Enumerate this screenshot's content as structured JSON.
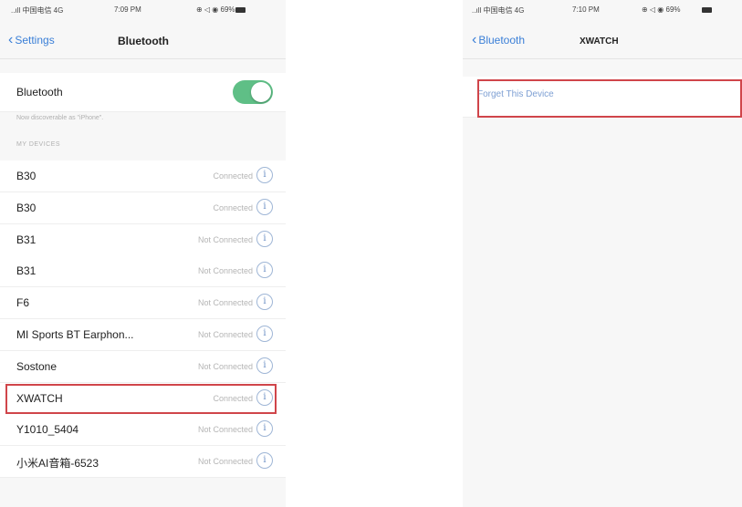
{
  "left": {
    "status": {
      "carrier": "..ıll 中国电信 4G",
      "time": "7:09 PM",
      "battery": "⊕ ◁ ◉ 69%"
    },
    "nav": {
      "back": "Settings",
      "title": "Bluetooth"
    },
    "bluetooth": {
      "label": "Bluetooth",
      "enabled": true,
      "discoverable": "Now discoverable as \"iPhone\"."
    },
    "section_header": "MY DEVICES",
    "devices": [
      {
        "name": "B30",
        "status": "Connected"
      },
      {
        "name": "B30",
        "status": "Connected"
      },
      {
        "name": "B31",
        "status": "Not Connected"
      },
      {
        "name": "B31",
        "status": "Not Connected"
      },
      {
        "name": "F6",
        "status": "Not Connected"
      },
      {
        "name": "MI Sports BT Earphon...",
        "status": "Not Connected"
      },
      {
        "name": "Sostone",
        "status": "Not Connected"
      },
      {
        "name": "XWATCH",
        "status": "Connected"
      },
      {
        "name": "Y1010_5404",
        "status": "Not Connected"
      },
      {
        "name": "小米AI音箱-6523",
        "status": "Not Connected"
      }
    ],
    "info_glyph": "i"
  },
  "right": {
    "status": {
      "carrier": "..ıll 中国电信 4G",
      "time": "7:10 PM",
      "battery": "⊕ ◁ ◉ 69%"
    },
    "nav": {
      "back": "Bluetooth",
      "title": "XWATCH"
    },
    "forget_label": "Forget This Device"
  },
  "colors": {
    "accent": "#3a7fd7",
    "toggle_on": "#5fbf86",
    "highlight": "#d0454a"
  }
}
